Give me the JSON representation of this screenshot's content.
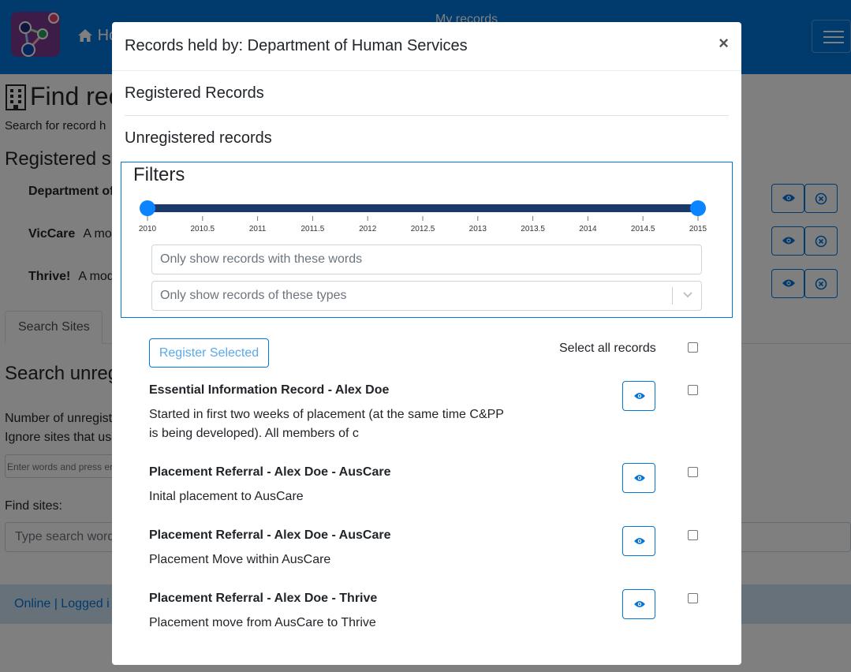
{
  "navbar": {
    "home_label": "Ho",
    "center_label": "My records"
  },
  "page": {
    "title": "Find rec",
    "subtitle": "Search for record h",
    "registered_heading": "Registered si",
    "sites": [
      {
        "name": "Department of",
        "desc": ""
      },
      {
        "name": "VicCare",
        "desc": "A mo"
      },
      {
        "name": "Thrive!",
        "desc": "A mod"
      }
    ],
    "tab_label": "Search Sites",
    "search_heading": "Search unreg",
    "unregistered_line1": "Number of unregist",
    "unregistered_line2": "Ignore sites that use",
    "words_placeholder": "Enter words and press er",
    "find_sites_label": "Find sites:",
    "find_sites_placeholder": "Type search word",
    "footer_text": "Online | Logged i"
  },
  "modal": {
    "title": "Records held by: Department of Human Services",
    "close_glyph": "×",
    "registered_label": "Registered Records",
    "unregistered_label": "Unregistered records",
    "filters": {
      "title": "Filters",
      "slider_min": 2010,
      "slider_max": 2015,
      "slider_low": 2010,
      "slider_high": 2015,
      "ticks": [
        "2010",
        "2010.5",
        "2011",
        "2011.5",
        "2012",
        "2012.5",
        "2013",
        "2013.5",
        "2014",
        "2014.5",
        "2015"
      ],
      "words_placeholder": "Only show records with these words",
      "types_placeholder": "Only show records of these types"
    },
    "register_button": "Register Selected",
    "select_all_label": "Select all records",
    "records": [
      {
        "title": "Essential Information Record - Alex Doe",
        "desc": "Started in first two weeks of placement (at the same time C&PP is being developed). All members of c"
      },
      {
        "title": "Placement Referral - Alex Doe - AusCare",
        "desc": "Inital placement to AusCare"
      },
      {
        "title": "Placement Referral - Alex Doe - AusCare",
        "desc": "Placement Move within AusCare"
      },
      {
        "title": "Placement Referral - Alex Doe - Thrive",
        "desc": "Placement move from AusCare to Thrive"
      }
    ]
  },
  "colors": {
    "primary": "#0275d8",
    "slider_track": "#1b3a6b",
    "slider_handle": "#0a84ff",
    "footer_bg": "#cfe2f3"
  }
}
